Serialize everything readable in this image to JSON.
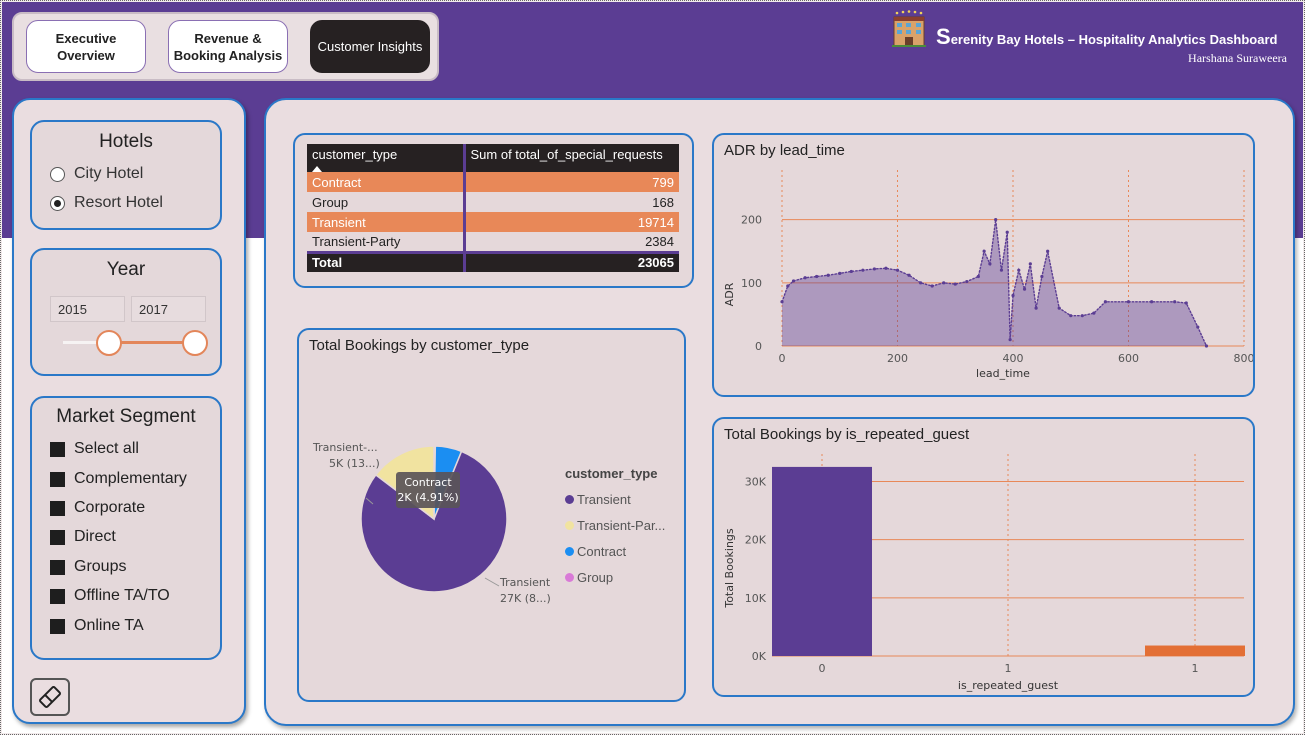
{
  "nav": {
    "tab1": "Executive Overview",
    "tab2": "Revenue & Booking Analysis",
    "tab3": "Customer Insights"
  },
  "header": {
    "title_initial": "S",
    "title_rest": "erenity Bay Hotels – Hospitality Analytics Dashboard",
    "author": "Harshana Suraweera"
  },
  "filters": {
    "hotels": {
      "title": "Hotels",
      "options": [
        "City Hotel",
        "Resort Hotel"
      ],
      "selected": "Resort Hotel"
    },
    "year": {
      "title": "Year",
      "from": "2015",
      "to": "2017"
    },
    "market_segment": {
      "title": "Market Segment",
      "options": [
        "Select all",
        "Complementary",
        "Corporate",
        "Direct",
        "Groups",
        "Offline TA/TO",
        "Online TA"
      ]
    }
  },
  "table": {
    "headers": [
      "customer_type",
      "Sum of total_of_special_requests"
    ],
    "rows": [
      {
        "type": "Contract",
        "value": "799"
      },
      {
        "type": "Group",
        "value": "168"
      },
      {
        "type": "Transient",
        "value": "19714"
      },
      {
        "type": "Transient-Party",
        "value": "2384"
      }
    ],
    "total_label": "Total",
    "total_value": "23065"
  },
  "colors": {
    "purple": "#5b3d93",
    "orange": "#e88858",
    "yellow": "#f1e3a0",
    "blue": "#1b8ef2",
    "pink": "#d97ad7",
    "dark": "#262122"
  },
  "pie_chart": {
    "title": "Total Bookings by customer_type",
    "legend_title": "customer_type",
    "legend": [
      "Transient",
      "Transient-Par...",
      "Contract",
      "Group"
    ],
    "labels": {
      "transient_name": "Transient",
      "transient_value": "27K (8...)",
      "tparty_name": "Transient-...",
      "tparty_value": "5K (13...)",
      "tooltip_name": "Contract",
      "tooltip_value": "2K (4.91%)"
    }
  },
  "chart_data": [
    {
      "type": "pie",
      "title": "Total Bookings by customer_type",
      "categories": [
        "Transient",
        "Transient-Party",
        "Contract",
        "Group"
      ],
      "values": [
        27000,
        5000,
        2000,
        100
      ]
    },
    {
      "type": "area",
      "title": "ADR by lead_time",
      "xlabel": "lead_time",
      "ylabel": "ADR",
      "xlim": [
        0,
        800
      ],
      "ylim": [
        0,
        220
      ],
      "xticks": [
        "0",
        "200",
        "400",
        "600",
        "800"
      ],
      "yticks": [
        "0",
        "100",
        "200"
      ],
      "x": [
        0,
        10,
        20,
        40,
        60,
        80,
        100,
        120,
        140,
        160,
        180,
        200,
        220,
        240,
        260,
        280,
        300,
        320,
        340,
        350,
        360,
        370,
        380,
        390,
        395,
        400,
        410,
        420,
        430,
        440,
        450,
        460,
        480,
        500,
        520,
        540,
        560,
        600,
        640,
        680,
        700,
        720,
        735
      ],
      "values": [
        70,
        95,
        103,
        108,
        110,
        112,
        115,
        118,
        120,
        122,
        123,
        120,
        112,
        100,
        95,
        100,
        98,
        102,
        110,
        150,
        130,
        200,
        120,
        180,
        10,
        80,
        120,
        90,
        130,
        60,
        110,
        150,
        60,
        48,
        48,
        52,
        70,
        70,
        70,
        70,
        68,
        30,
        0
      ]
    },
    {
      "type": "bar",
      "title": "Total Bookings by is_repeated_guest",
      "xlabel": "is_repeated_guest",
      "ylabel": "Total Bookings",
      "categories": [
        "0",
        "1",
        "1"
      ],
      "values": [
        32500,
        0,
        1800
      ],
      "ylim": [
        0,
        33000
      ],
      "yticks": [
        "0K",
        "10K",
        "20K",
        "30K"
      ]
    }
  ]
}
